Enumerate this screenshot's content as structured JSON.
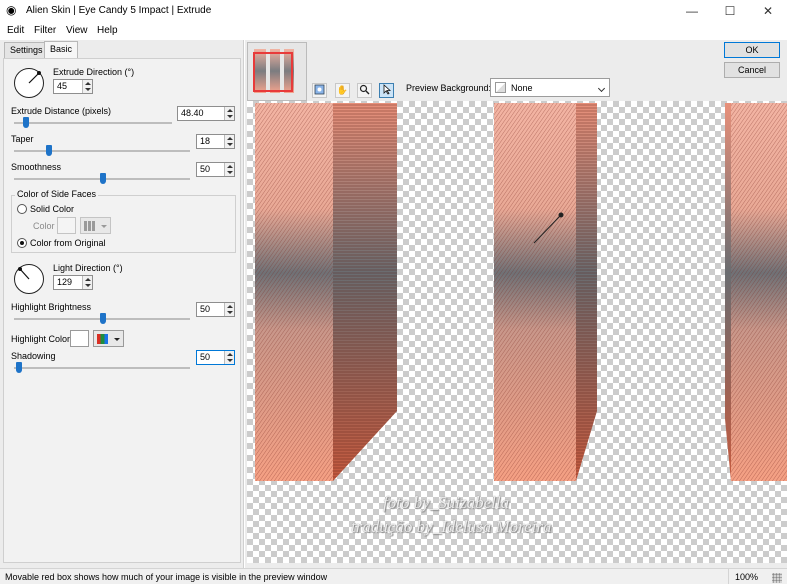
{
  "window": {
    "title": "Alien Skin | Eye Candy 5 Impact | Extrude",
    "minimize_glyph": "—",
    "maximize_glyph": "☐",
    "close_glyph": "✕"
  },
  "menu": [
    "Edit",
    "Filter",
    "View",
    "Help"
  ],
  "tabs": [
    "Settings",
    "Basic"
  ],
  "active_tab": "Basic",
  "controls": {
    "extrude_direction": {
      "label": "Extrude Direction (°)",
      "value": "45"
    },
    "extrude_distance": {
      "label": "Extrude Distance (pixels)",
      "value": "48.40",
      "slider_fraction": 0.08
    },
    "taper": {
      "label": "Taper",
      "value": "18",
      "slider_fraction": 0.18
    },
    "smoothness": {
      "label": "Smoothness",
      "value": "50",
      "slider_fraction": 0.5
    },
    "side_faces": {
      "group_label": "Color of Side Faces",
      "solid_color": "Solid Color",
      "color_label": "Color",
      "from_original": "Color from Original",
      "selected": "Color from Original"
    },
    "light_direction": {
      "label": "Light Direction (°)",
      "value": "129"
    },
    "highlight_brightness": {
      "label": "Highlight Brightness",
      "value": "50",
      "slider_fraction": 0.5
    },
    "highlight_color": {
      "label": "Highlight Color",
      "color": "#ffffff"
    },
    "shadowing": {
      "label": "Shadowing",
      "value": "50",
      "slider_fraction": 0.02
    }
  },
  "buttons": {
    "ok": "OK",
    "cancel": "Cancel"
  },
  "preview_toolbar": {
    "preview_background_label": "Preview Background:",
    "preview_background_value": "None",
    "tools": [
      "eye-toggle-icon",
      "hand-icon",
      "zoom-icon",
      "arrow-pointer-icon"
    ],
    "active_tool": "arrow-pointer-icon"
  },
  "preview": {
    "watermark_line1": "foto by_Suizabella",
    "watermark_line2": "tradução by_Idelusa Moreira",
    "colors": {
      "salmon": "#f29a82",
      "gray": "#6b6d72",
      "dark": "#b84a30"
    }
  },
  "status": {
    "message": "Movable red box shows how much of your image is visible in the preview window",
    "zoom": "100%"
  },
  "colors": {
    "accent": "#0078d7",
    "slider": "#1e73c8"
  }
}
